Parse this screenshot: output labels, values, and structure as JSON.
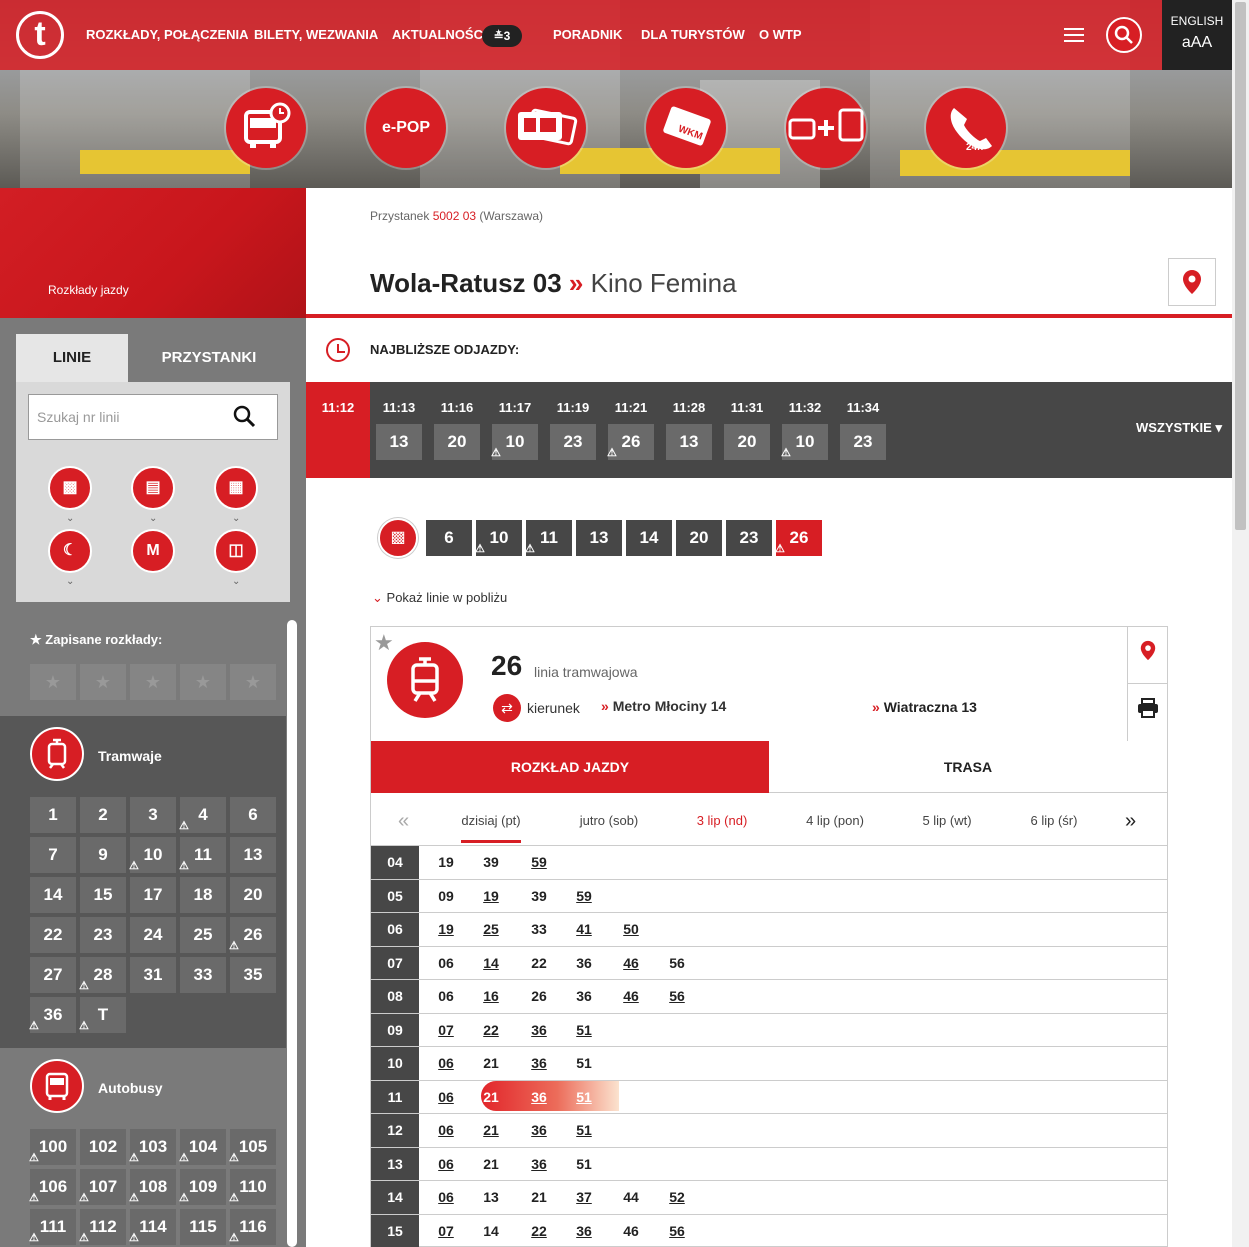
{
  "header": {
    "logo": "t",
    "nav": [
      "ROZKŁADY, POŁĄCZENIA",
      "BILETY, WEZWANIA",
      "AKTUALNOŚCI",
      "PORADNIK",
      "DLA TURYSTÓW",
      "O WTP"
    ],
    "news_badge": "≛3",
    "lang": "ENGLISH",
    "font_size": "aAA",
    "circles": [
      "timetable-bus-icon",
      "e-POP",
      "ticket-cards-icon",
      "WKM",
      "bus-plus-bus-icon",
      "phone-24h-icon"
    ],
    "epop": "e-POP",
    "wkm": "WKM",
    "h24": "24h"
  },
  "sidebar": {
    "breadcrumb": "Rozkłady jazdy",
    "tabs": [
      "LINIE",
      "PRZYSTANKI"
    ],
    "search_placeholder": "Szukaj nr linii",
    "saved_label": "Zapisane rozkłady:",
    "tram_label": "Tramwaje",
    "bus_label": "Autobusy",
    "tram_lines": [
      {
        "n": "1",
        "w": false
      },
      {
        "n": "2",
        "w": false
      },
      {
        "n": "3",
        "w": false
      },
      {
        "n": "4",
        "w": true
      },
      {
        "n": "6",
        "w": false
      },
      {
        "n": "7",
        "w": false
      },
      {
        "n": "9",
        "w": false
      },
      {
        "n": "10",
        "w": true
      },
      {
        "n": "11",
        "w": true
      },
      {
        "n": "13",
        "w": false
      },
      {
        "n": "14",
        "w": false
      },
      {
        "n": "15",
        "w": false
      },
      {
        "n": "17",
        "w": false
      },
      {
        "n": "18",
        "w": false
      },
      {
        "n": "20",
        "w": false
      },
      {
        "n": "22",
        "w": false
      },
      {
        "n": "23",
        "w": false
      },
      {
        "n": "24",
        "w": false
      },
      {
        "n": "25",
        "w": false
      },
      {
        "n": "26",
        "w": true
      },
      {
        "n": "27",
        "w": false
      },
      {
        "n": "28",
        "w": true
      },
      {
        "n": "31",
        "w": false
      },
      {
        "n": "33",
        "w": false
      },
      {
        "n": "35",
        "w": false
      },
      {
        "n": "36",
        "w": true
      },
      {
        "n": "T",
        "w": true
      }
    ],
    "bus_lines": [
      {
        "n": "100",
        "w": true
      },
      {
        "n": "102",
        "w": false
      },
      {
        "n": "103",
        "w": true
      },
      {
        "n": "104",
        "w": true
      },
      {
        "n": "105",
        "w": true
      },
      {
        "n": "106",
        "w": true
      },
      {
        "n": "107",
        "w": true
      },
      {
        "n": "108",
        "w": true
      },
      {
        "n": "109",
        "w": true
      },
      {
        "n": "110",
        "w": true
      },
      {
        "n": "111",
        "w": true
      },
      {
        "n": "112",
        "w": true
      },
      {
        "n": "114",
        "w": true
      },
      {
        "n": "115",
        "w": false
      },
      {
        "n": "116",
        "w": true
      }
    ]
  },
  "stop": {
    "crumb_pre": "Przystanek ",
    "crumb_code": "5002 03",
    "crumb_post": " (Warszawa)",
    "name": "Wola-Ratusz 03",
    "sep": "»",
    "sub": "Kino Femina"
  },
  "departures": {
    "label": "NAJBLIŻSZE ODJAZDY:",
    "now": "11:12",
    "items": [
      {
        "t": "11:13",
        "l": "13",
        "w": false
      },
      {
        "t": "11:16",
        "l": "20",
        "w": false
      },
      {
        "t": "11:17",
        "l": "10",
        "w": true
      },
      {
        "t": "11:19",
        "l": "23",
        "w": false
      },
      {
        "t": "11:21",
        "l": "26",
        "w": true
      },
      {
        "t": "11:28",
        "l": "13",
        "w": false
      },
      {
        "t": "11:31",
        "l": "20",
        "w": false
      },
      {
        "t": "11:32",
        "l": "10",
        "w": true
      },
      {
        "t": "11:34",
        "l": "23",
        "w": false
      }
    ],
    "all_label": "WSZYSTKIE"
  },
  "filter_lines": [
    {
      "n": "6",
      "w": false
    },
    {
      "n": "10",
      "w": true
    },
    {
      "n": "11",
      "w": true
    },
    {
      "n": "13",
      "w": false
    },
    {
      "n": "14",
      "w": false
    },
    {
      "n": "20",
      "w": false
    },
    {
      "n": "23",
      "w": false
    },
    {
      "n": "26",
      "w": true,
      "active": true
    }
  ],
  "nearby_label": "Pokaż linie w pobliżu",
  "line": {
    "number": "26",
    "type": "linia tramwajowa",
    "dir_label": "kierunek",
    "dir1": "Metro Młociny 14",
    "dir2": "Wiatraczna 13",
    "tab_timetable": "ROZKŁAD JAZDY",
    "tab_route": "TRASA"
  },
  "days": [
    {
      "l": "dzisiaj (pt)",
      "sun": false
    },
    {
      "l": "jutro (sob)",
      "sun": false
    },
    {
      "l": "3 lip (nd)",
      "sun": true
    },
    {
      "l": "4 lip (pon)",
      "sun": false
    },
    {
      "l": "5 lip (wt)",
      "sun": false
    },
    {
      "l": "6 lip (śr)",
      "sun": false
    }
  ],
  "timetable": [
    {
      "h": "04",
      "m": [
        [
          "19",
          0
        ],
        [
          "39",
          0
        ],
        [
          "59",
          1
        ]
      ]
    },
    {
      "h": "05",
      "m": [
        [
          "09",
          0
        ],
        [
          "19",
          1
        ],
        [
          "39",
          0
        ],
        [
          "59",
          1
        ]
      ]
    },
    {
      "h": "06",
      "m": [
        [
          "19",
          1
        ],
        [
          "25",
          1
        ],
        [
          "33",
          0
        ],
        [
          "41",
          1
        ],
        [
          "50",
          1
        ]
      ]
    },
    {
      "h": "07",
      "m": [
        [
          "06",
          0
        ],
        [
          "14",
          1
        ],
        [
          "22",
          0
        ],
        [
          "36",
          0
        ],
        [
          "46",
          1
        ],
        [
          "56",
          0
        ]
      ]
    },
    {
      "h": "08",
      "m": [
        [
          "06",
          0
        ],
        [
          "16",
          1
        ],
        [
          "26",
          0
        ],
        [
          "36",
          0
        ],
        [
          "46",
          1
        ],
        [
          "56",
          1
        ]
      ]
    },
    {
      "h": "09",
      "m": [
        [
          "07",
          1
        ],
        [
          "22",
          1
        ],
        [
          "36",
          1
        ],
        [
          "51",
          1
        ]
      ]
    },
    {
      "h": "10",
      "m": [
        [
          "06",
          1
        ],
        [
          "21",
          0
        ],
        [
          "36",
          1
        ],
        [
          "51",
          0
        ]
      ]
    },
    {
      "h": "11",
      "m": [
        [
          "06",
          1
        ],
        [
          "21",
          0
        ],
        [
          "36",
          1
        ],
        [
          "51",
          1
        ]
      ],
      "cur": true
    },
    {
      "h": "12",
      "m": [
        [
          "06",
          1
        ],
        [
          "21",
          1
        ],
        [
          "36",
          1
        ],
        [
          "51",
          1
        ]
      ]
    },
    {
      "h": "13",
      "m": [
        [
          "06",
          1
        ],
        [
          "21",
          0
        ],
        [
          "36",
          1
        ],
        [
          "51",
          0
        ]
      ]
    },
    {
      "h": "14",
      "m": [
        [
          "06",
          1
        ],
        [
          "13",
          0
        ],
        [
          "21",
          0
        ],
        [
          "37",
          1
        ],
        [
          "44",
          0
        ],
        [
          "52",
          1
        ]
      ]
    },
    {
      "h": "15",
      "m": [
        [
          "07",
          1
        ],
        [
          "14",
          0
        ],
        [
          "22",
          1
        ],
        [
          "36",
          1
        ],
        [
          "46",
          0
        ],
        [
          "56",
          1
        ]
      ]
    }
  ],
  "colors": {
    "brand_red": "#d71e24",
    "dark": "#474747"
  }
}
